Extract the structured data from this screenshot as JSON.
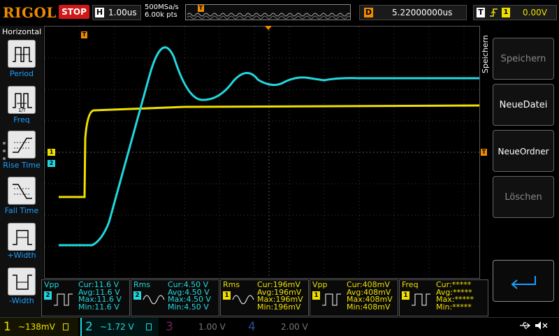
{
  "header": {
    "logo": "RIGOL",
    "run_state": "STOP",
    "h_label": "H",
    "timebase": "1.00us",
    "sample_rate": "500MSa/s",
    "mem_points": "6.00k pts",
    "trigger_pos_marker": "T",
    "delay_label": "D",
    "delay_value": "5.22000000us",
    "trigger_label": "T",
    "trigger_edge": "rising",
    "trigger_channel": "1",
    "trigger_level": "0.00V"
  },
  "left_menu": {
    "title": "Horizontal",
    "items": [
      {
        "label": "Period"
      },
      {
        "label": "Freq"
      },
      {
        "label": "Rise Time"
      },
      {
        "label": "Fall Time"
      },
      {
        "label": "+Width"
      },
      {
        "label": "-Width"
      }
    ]
  },
  "right_menu": {
    "title": "Speichern",
    "buttons": [
      {
        "label": "Speichern",
        "enabled": false
      },
      {
        "label": "NeueDatei",
        "enabled": true
      },
      {
        "label": "NeueOrdner",
        "enabled": true
      },
      {
        "label": "Löschen",
        "enabled": false
      }
    ],
    "back_icon": "return-arrow-icon"
  },
  "screen_markers": {
    "trigger_top": "T",
    "ch1": "1",
    "ch2": "2",
    "trigger_level_marker": "T"
  },
  "measurements": [
    {
      "name": "Vpp",
      "channel": "2",
      "icon": "pulse-icon",
      "cur": "Cur:11.6 V",
      "avg": "Avg:11.6 V",
      "max": "Max:11.6 V",
      "min": "Min:11.6 V"
    },
    {
      "name": "Rms",
      "channel": "2",
      "icon": "sine-icon",
      "cur": "Cur:4.50 V",
      "avg": "Avg:4.50 V",
      "max": "Max:4.50 V",
      "min": "Min:4.50 V"
    },
    {
      "name": "Rms",
      "channel": "1",
      "icon": "sine-icon",
      "cur": "Cur:196mV",
      "avg": "Avg:196mV",
      "max": "Max:196mV",
      "min": "Min:196mV"
    },
    {
      "name": "Vpp",
      "channel": "1",
      "icon": "pulse-icon",
      "cur": "Cur:408mV",
      "avg": "Avg:408mV",
      "max": "Max:408mV",
      "min": "Min:408mV"
    },
    {
      "name": "Freq",
      "channel": "1",
      "icon": "pulse-icon",
      "cur": "Cur:*****",
      "avg": "Avg:*****",
      "max": "Max:*****",
      "min": "Min:*****"
    }
  ],
  "channels": [
    {
      "num": "1",
      "value": "138mV",
      "coupling": "~",
      "color": "#f0e000",
      "active": true
    },
    {
      "num": "2",
      "value": "1.72 V",
      "coupling": "~",
      "color": "#00e0e8",
      "active": true
    },
    {
      "num": "3",
      "value": "1.00 V",
      "coupling": "",
      "color": "#a02070",
      "active": false
    },
    {
      "num": "4",
      "value": "2.00 V",
      "coupling": "",
      "color": "#2040a0",
      "active": false
    }
  ],
  "colors": {
    "ch1": "#f0e000",
    "ch2": "#22d8e0",
    "trigger": "#f08a00",
    "menu_label": "#1aa0ff"
  }
}
